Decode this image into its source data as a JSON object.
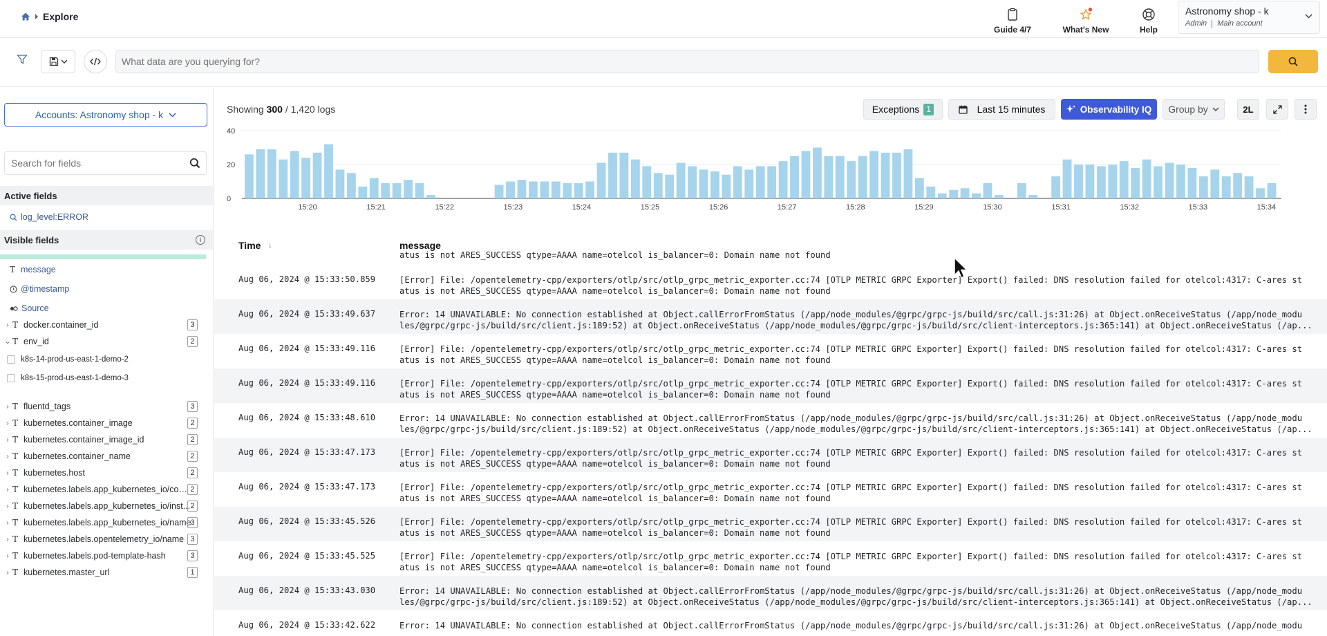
{
  "breadcrumb": {
    "page": "Explore"
  },
  "topbar": {
    "guide_label": "Guide 4/7",
    "whats_new_label": "What's New",
    "help_label": "Help",
    "account_name": "Astronomy shop - k",
    "account_role": "Admin",
    "account_type": "Main account"
  },
  "query": {
    "placeholder": "What data are you querying for?"
  },
  "sidebar": {
    "accounts_label": "Accounts: Astronomy shop - k",
    "field_search_placeholder": "Search for fields",
    "active_fields_title": "Active fields",
    "active_fields": [
      "log_level:ERROR"
    ],
    "visible_fields_title": "Visible fields",
    "visible_fields": [
      "message",
      "@timestamp",
      "Source"
    ],
    "fields": [
      {
        "name": "docker.container_id",
        "count": "3",
        "expanded": false
      },
      {
        "name": "env_id",
        "count": "2",
        "expanded": true,
        "values": [
          "k8s-14-prod-us-east-1-demo-2",
          "k8s-15-prod-us-east-1-demo-3"
        ]
      },
      {
        "name": "fluentd_tags",
        "count": "3",
        "expanded": false
      },
      {
        "name": "kubernetes.container_image",
        "count": "2",
        "expanded": false
      },
      {
        "name": "kubernetes.container_image_id",
        "count": "2",
        "expanded": false
      },
      {
        "name": "kubernetes.container_name",
        "count": "2",
        "expanded": false
      },
      {
        "name": "kubernetes.host",
        "count": "2",
        "expanded": false
      },
      {
        "name": "kubernetes.labels.app_kubernetes_io/com...",
        "count": "2",
        "expanded": false
      },
      {
        "name": "kubernetes.labels.app_kubernetes_io/inst...",
        "count": "2",
        "expanded": false
      },
      {
        "name": "kubernetes.labels.app_kubernetes_io/name",
        "count": "3",
        "expanded": false
      },
      {
        "name": "kubernetes.labels.opentelemetry_io/name",
        "count": "3",
        "expanded": false
      },
      {
        "name": "kubernetes.labels.pod-template-hash",
        "count": "3",
        "expanded": false
      },
      {
        "name": "kubernetes.master_url",
        "count": "1",
        "expanded": false
      }
    ]
  },
  "results": {
    "showing_prefix": "Showing",
    "showing_count": "300",
    "showing_total": "/ 1,420 logs",
    "exceptions_label": "Exceptions",
    "exceptions_count": "1",
    "time_range_label": "Last 15 minutes",
    "observability_label": "Observability IQ",
    "group_by_label": "Group by",
    "density_label": "2L"
  },
  "chart_data": {
    "type": "bar",
    "y_ticks": [
      "40",
      "20",
      "0"
    ],
    "ylim": [
      0,
      40
    ],
    "x_tick_labels": [
      "15:20",
      "15:21",
      "15:22",
      "15:23",
      "15:24",
      "15:25",
      "15:26",
      "15:27",
      "15:28",
      "15:29",
      "15:30",
      "15:31",
      "15:32",
      "15:33",
      "15:34"
    ],
    "values": [
      26,
      29,
      29,
      23,
      28,
      24,
      27,
      32,
      17,
      15,
      7,
      12,
      9,
      9,
      11,
      9,
      2,
      0,
      0,
      0,
      0,
      0,
      8,
      10,
      11,
      10,
      10,
      10,
      9,
      9,
      10,
      21,
      27,
      27,
      23,
      19,
      15,
      14,
      21,
      19,
      17,
      16,
      14,
      19,
      17,
      19,
      19,
      22,
      25,
      28,
      30,
      25,
      25,
      22,
      25,
      28,
      27,
      27,
      29,
      12,
      7,
      3,
      5,
      6,
      3,
      9,
      2,
      0,
      9,
      2,
      0,
      13,
      23,
      20,
      20,
      19,
      20,
      22,
      18,
      23,
      19,
      21,
      20,
      18,
      13,
      17,
      13,
      15,
      13,
      6,
      9
    ]
  },
  "table": {
    "col_time": "Time",
    "col_message": "message",
    "ghost_time": "Aug 06, 2024 @ 15:33:50.859",
    "ghost_message": "[Error] File: /opentelemetry-cpp/exporters/otlp/src/otlp_grpc_metric_exporter.cc:74 [OTLP METRIC GRPC Exporter] Export() failed: DNS resolution failed for otelcol:4317: C-ares st",
    "first_message_tail": "atus is not ARES_SUCCESS qtype=AAAA name=otelcol is_balancer=0: Domain name not found",
    "rows": [
      {
        "time": "Aug 06, 2024 @ 15:33:50.859",
        "line1": "[Error] File: /opentelemetry-cpp/exporters/otlp/src/otlp_grpc_metric_exporter.cc:74 [OTLP METRIC GRPC Exporter] Export() failed: DNS resolution failed for otelcol:4317: C-ares st",
        "line2": "atus is not ARES_SUCCESS qtype=AAAA name=otelcol is_balancer=0: Domain name not found"
      },
      {
        "time": "Aug 06, 2024 @ 15:33:49.637",
        "line1": "Error: 14 UNAVAILABLE: No connection established at Object.callErrorFromStatus (/app/node_modules/@grpc/grpc-js/build/src/call.js:31:26) at Object.onReceiveStatus (/app/node_modu",
        "line2": "les/@grpc/grpc-js/build/src/client.js:189:52) at Object.onReceiveStatus (/app/node_modules/@grpc/grpc-js/build/src/client-interceptors.js:365:141) at Object.onReceiveStatus (/ap..."
      },
      {
        "time": "Aug 06, 2024 @ 15:33:49.116",
        "line1": "[Error] File: /opentelemetry-cpp/exporters/otlp/src/otlp_grpc_metric_exporter.cc:74 [OTLP METRIC GRPC Exporter] Export() failed: DNS resolution failed for otelcol:4317: C-ares st",
        "line2": "atus is not ARES_SUCCESS qtype=AAAA name=otelcol is_balancer=0: Domain name not found"
      },
      {
        "time": "Aug 06, 2024 @ 15:33:49.116",
        "line1": "[Error] File: /opentelemetry-cpp/exporters/otlp/src/otlp_grpc_metric_exporter.cc:74 [OTLP METRIC GRPC Exporter] Export() failed: DNS resolution failed for otelcol:4317: C-ares st",
        "line2": "atus is not ARES_SUCCESS qtype=AAAA name=otelcol is_balancer=0: Domain name not found"
      },
      {
        "time": "Aug 06, 2024 @ 15:33:48.610",
        "line1": "Error: 14 UNAVAILABLE: No connection established at Object.callErrorFromStatus (/app/node_modules/@grpc/grpc-js/build/src/call.js:31:26) at Object.onReceiveStatus (/app/node_modu",
        "line2": "les/@grpc/grpc-js/build/src/client.js:189:52) at Object.onReceiveStatus (/app/node_modules/@grpc/grpc-js/build/src/client-interceptors.js:365:141) at Object.onReceiveStatus (/ap..."
      },
      {
        "time": "Aug 06, 2024 @ 15:33:47.173",
        "line1": "[Error] File: /opentelemetry-cpp/exporters/otlp/src/otlp_grpc_metric_exporter.cc:74 [OTLP METRIC GRPC Exporter] Export() failed: DNS resolution failed for otelcol:4317: C-ares st",
        "line2": "atus is not ARES_SUCCESS qtype=AAAA name=otelcol is_balancer=0: Domain name not found"
      },
      {
        "time": "Aug 06, 2024 @ 15:33:47.173",
        "line1": "[Error] File: /opentelemetry-cpp/exporters/otlp/src/otlp_grpc_metric_exporter.cc:74 [OTLP METRIC GRPC Exporter] Export() failed: DNS resolution failed for otelcol:4317: C-ares st",
        "line2": "atus is not ARES_SUCCESS qtype=AAAA name=otelcol is_balancer=0: Domain name not found"
      },
      {
        "time": "Aug 06, 2024 @ 15:33:45.526",
        "line1": "[Error] File: /opentelemetry-cpp/exporters/otlp/src/otlp_grpc_metric_exporter.cc:74 [OTLP METRIC GRPC Exporter] Export() failed: DNS resolution failed for otelcol:4317: C-ares st",
        "line2": "atus is not ARES_SUCCESS qtype=AAAA name=otelcol is_balancer=0: Domain name not found"
      },
      {
        "time": "Aug 06, 2024 @ 15:33:45.525",
        "line1": "[Error] File: /opentelemetry-cpp/exporters/otlp/src/otlp_grpc_metric_exporter.cc:74 [OTLP METRIC GRPC Exporter] Export() failed: DNS resolution failed for otelcol:4317: C-ares st",
        "line2": "atus is not ARES_SUCCESS qtype=AAAA name=otelcol is_balancer=0: Domain name not found"
      },
      {
        "time": "Aug 06, 2024 @ 15:33:43.030",
        "line1": "Error: 14 UNAVAILABLE: No connection established at Object.callErrorFromStatus (/app/node_modules/@grpc/grpc-js/build/src/call.js:31:26) at Object.onReceiveStatus (/app/node_modu",
        "line2": "les/@grpc/grpc-js/build/src/client.js:189:52) at Object.onReceiveStatus (/app/node_modules/@grpc/grpc-js/build/src/client-interceptors.js:365:141) at Object.onReceiveStatus (/ap..."
      },
      {
        "time": "Aug 06, 2024 @ 15:33:42.622",
        "line1": "Error: 14 UNAVAILABLE: No connection established at Object.callErrorFromStatus (/app/node_modules/@grpc/grpc-js/build/src/call.js:31:26) at Object.onReceiveStatus (/app/node_modu",
        "line2": ""
      }
    ]
  },
  "colors": {
    "bar": "#a6d4ec",
    "accent_blue": "#3f5ad8",
    "search_button": "#f3b73d",
    "badge_green": "#5ab3a0",
    "notification_dot": "#e8553b"
  }
}
